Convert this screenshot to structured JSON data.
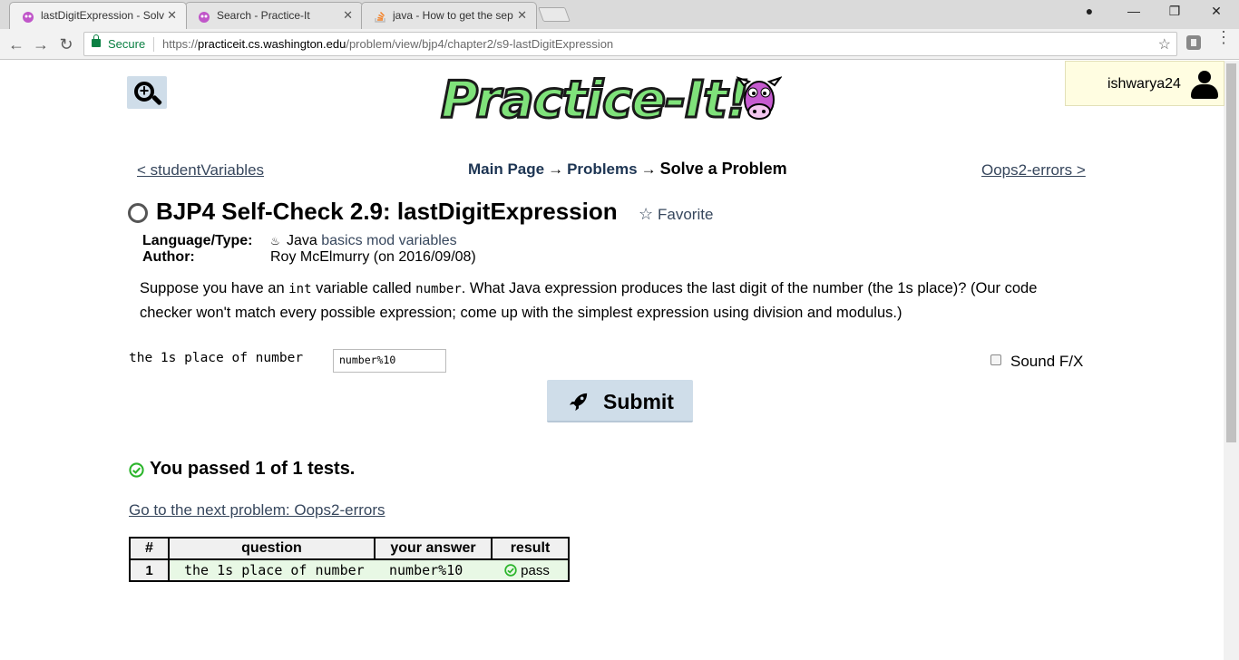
{
  "browser": {
    "tabs": [
      {
        "title": "lastDigitExpression - Solv",
        "active": true
      },
      {
        "title": "Search - Practice-It",
        "active": false
      },
      {
        "title": "java - How to get the sep",
        "active": false
      }
    ],
    "secure_label": "Secure",
    "url_scheme": "https://",
    "url_host": "practiceit.cs.washington.edu",
    "url_path": "/problem/view/bjp4/chapter2/s9-lastDigitExpression",
    "icons": [
      "back-arrow-icon",
      "forward-arrow-icon",
      "reload-icon",
      "lock-icon",
      "bookmark-star-icon",
      "extension-icon",
      "menu-icon",
      "profile-icon",
      "minimize-icon",
      "restore-icon",
      "close-icon"
    ]
  },
  "header": {
    "logo_text": "Practice-It!",
    "user": "ishwarya24"
  },
  "nav": {
    "prev": "< studentVariables",
    "next": "Oops2-errors >",
    "crumbs": {
      "main": "Main Page",
      "problems": "Problems",
      "current": "Solve a Problem",
      "arrow": "→"
    }
  },
  "problem": {
    "title": "BJP4 Self-Check 2.9: lastDigitExpression",
    "favorite": "Favorite",
    "meta": {
      "language_key": "Language/Type:",
      "language": "Java",
      "tags": [
        "basics",
        "mod",
        "variables"
      ],
      "author_key": "Author:",
      "author": "Roy McElmurry (on 2016/09/08)"
    },
    "description": {
      "p1": "Suppose you have an ",
      "code1": "int",
      "p2": " variable called ",
      "code2": "number",
      "p3": ". What Java expression produces the last digit of the number (the 1s place)? (Our code checker won't match every possible expression; come up with the simplest expression using division and modulus.)"
    }
  },
  "form": {
    "answer_label": "the 1s place of number",
    "answer_value": "number%10",
    "sound_label": "Sound F/X",
    "submit_label": "Submit"
  },
  "results": {
    "summary": "You passed 1 of 1 tests.",
    "next_link": "Go to the next problem: Oops2-errors",
    "headers": [
      "#",
      "question",
      "your answer",
      "result"
    ],
    "rows": [
      {
        "num": "1",
        "question": "the 1s place of number",
        "answer": "number%10",
        "result": "pass"
      }
    ],
    "pass_color": "#2bb52b"
  }
}
